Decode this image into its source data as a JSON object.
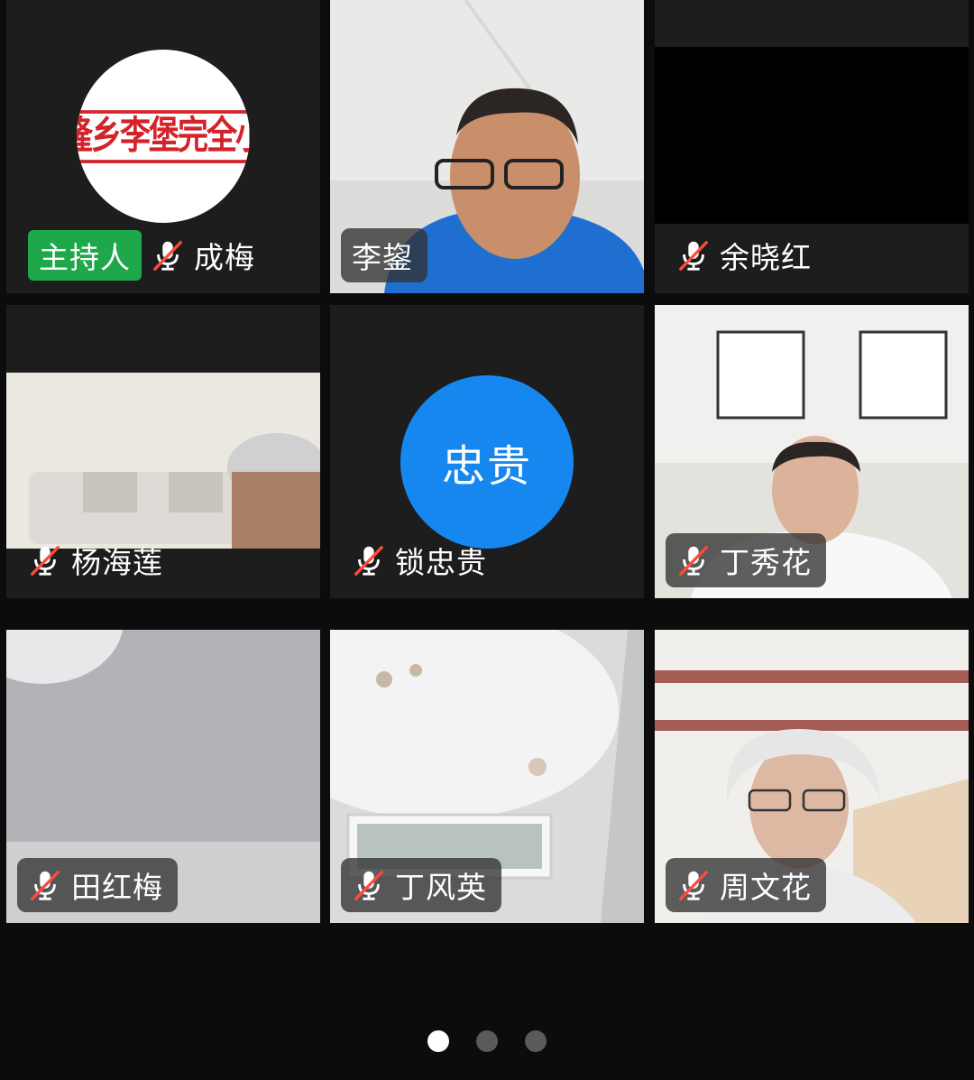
{
  "participants": [
    {
      "name": "成梅",
      "host_label": "主持人",
      "muted": true,
      "type": "logo",
      "logo_text": "兴隆乡李堡完全小学"
    },
    {
      "name": "李鋆",
      "muted": false,
      "type": "video"
    },
    {
      "name": "余晓红",
      "muted": true,
      "type": "blank"
    },
    {
      "name": "杨海莲",
      "muted": true,
      "type": "video"
    },
    {
      "name": "锁忠贵",
      "muted": true,
      "type": "avatar",
      "avatar_text": "忠贵"
    },
    {
      "name": "丁秀花",
      "muted": true,
      "type": "video"
    },
    {
      "name": "田红梅",
      "muted": true,
      "type": "video"
    },
    {
      "name": "丁风英",
      "muted": true,
      "type": "video"
    },
    {
      "name": "周文花",
      "muted": true,
      "type": "video"
    }
  ],
  "pagination": {
    "pages": 3,
    "current": 1
  },
  "icons": {
    "mic_muted": "mic-muted-icon"
  },
  "colors": {
    "host_badge": "#1fa84a",
    "avatar_bg": "#1687ee",
    "muted_slash": "#ff4a3d",
    "tile_bg": "#1d1d1d"
  }
}
